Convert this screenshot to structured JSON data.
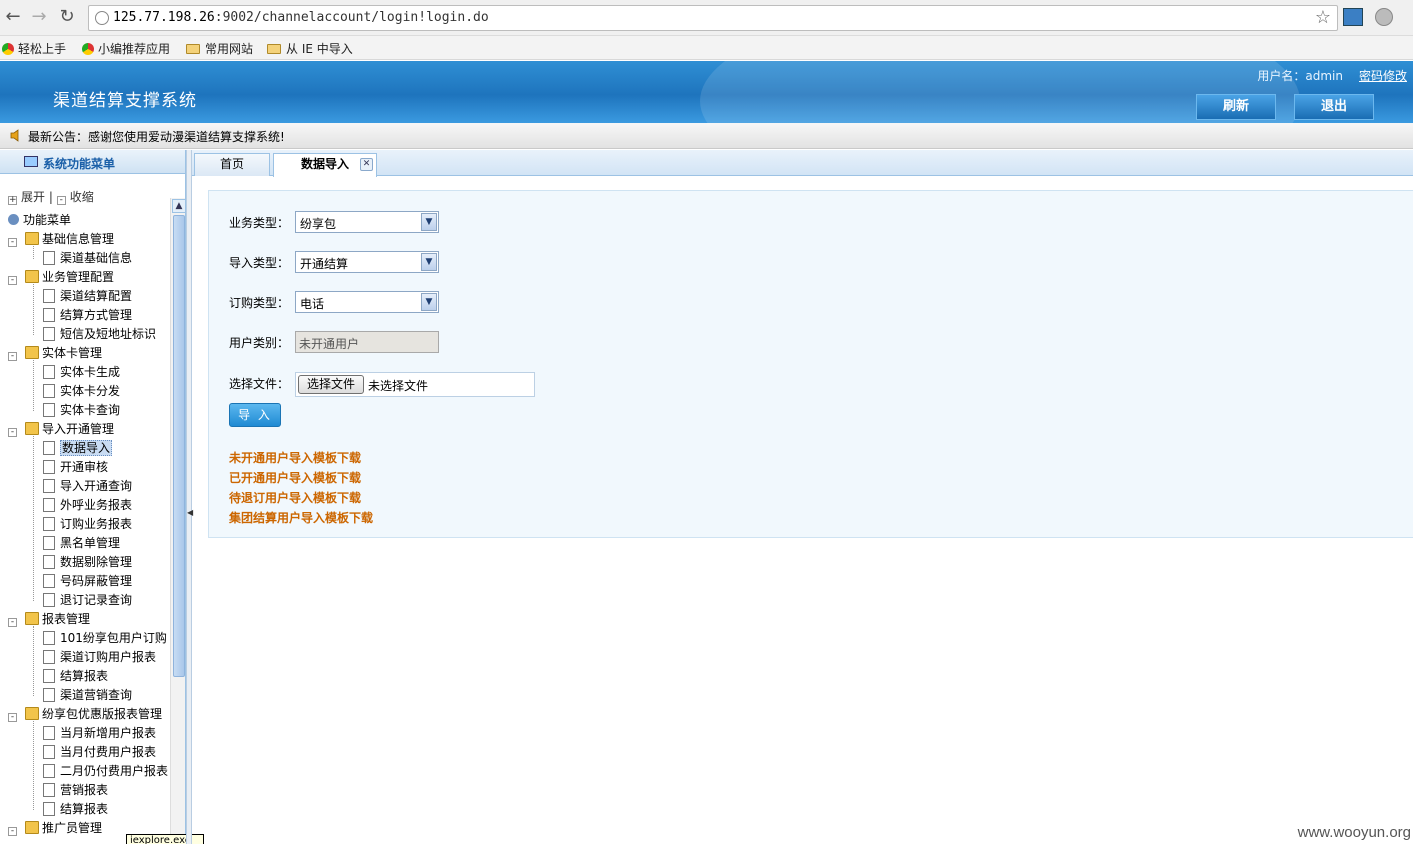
{
  "browser": {
    "url_host": "125.77.198.26",
    "url_rest": ":9002/channelaccount/login!login.do",
    "bookmarks": [
      "轻松上手",
      "小编推荐应用",
      "常用网站",
      "从 IE 中导入"
    ]
  },
  "header": {
    "title": "渠道结算支撑系统",
    "user_label": "用户名：admin",
    "change_password": "密码修改",
    "refresh_label": "刷新",
    "logout_label": "退出",
    "accent_color": "#1e74bd"
  },
  "notice": {
    "text": "最新公告：感谢您使用爱动漫渠道结算支撑系统!"
  },
  "sidebar": {
    "title": "系统功能菜单",
    "expand_label": "展开",
    "separator": "|",
    "collapse_label": "收缩",
    "root_label": "功能菜单",
    "groups": [
      {
        "label": "基础信息管理",
        "items": [
          "渠道基础信息"
        ]
      },
      {
        "label": "业务管理配置",
        "items": [
          "渠道结算配置",
          "结算方式管理",
          "短信及短地址标识"
        ]
      },
      {
        "label": "实体卡管理",
        "items": [
          "实体卡生成",
          "实体卡分发",
          "实体卡查询"
        ]
      },
      {
        "label": "导入开通管理",
        "items": [
          "数据导入",
          "开通审核",
          "导入开通查询",
          "外呼业务报表",
          "订购业务报表",
          "黑名单管理",
          "数据剔除管理",
          "号码屏蔽管理",
          "退订记录查询"
        ]
      },
      {
        "label": "报表管理",
        "items": [
          "101纷享包用户订购",
          "渠道订购用户报表",
          "结算报表",
          "渠道营销查询"
        ]
      },
      {
        "label": "纷享包优惠版报表管理",
        "items": [
          "当月新增用户报表",
          "当月付费用户报表",
          "二月仍付费用户报表",
          "营销报表",
          "结算报表"
        ]
      },
      {
        "label": "推广员管理",
        "items": []
      }
    ],
    "selected_item": "数据导入",
    "tooltip": "iexplore.exe"
  },
  "tabs": [
    {
      "label": "首页",
      "active": false
    },
    {
      "label": "数据导入",
      "active": true
    }
  ],
  "form": {
    "business_type": {
      "label": "业务类型：",
      "value": "纷享包"
    },
    "import_type": {
      "label": "导入类型：",
      "value": "开通结算"
    },
    "order_type": {
      "label": "订购类型：",
      "value": "电话"
    },
    "user_category": {
      "label": "用户类别：",
      "value": "未开通用户"
    },
    "file": {
      "label": "选择文件：",
      "button": "选择文件",
      "status": "未选择文件"
    },
    "submit_label": "导 入",
    "download_links": [
      "未开通用户导入模板下载",
      "已开通用户导入模板下载",
      "待退订用户导入模板下载",
      "集团结算用户导入模板下载"
    ],
    "link_color": "#cc6600"
  },
  "watermark": "www.wooyun.org"
}
